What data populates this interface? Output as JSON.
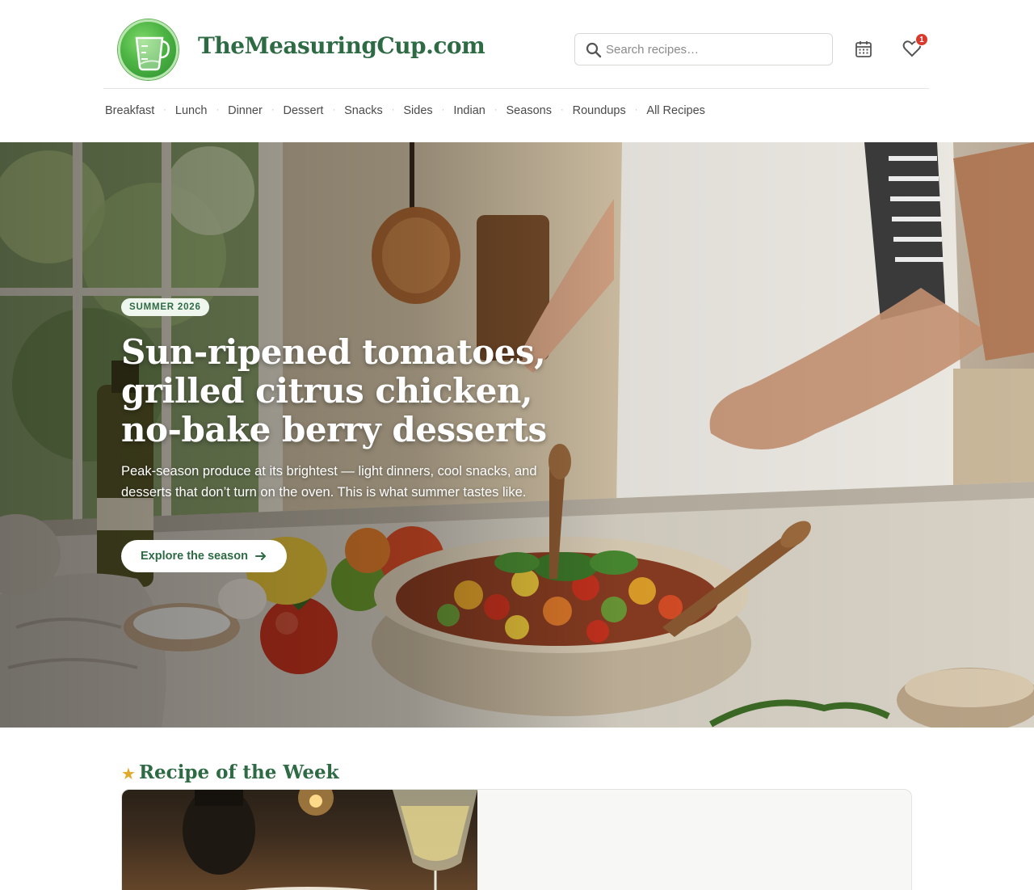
{
  "header": {
    "site_title": "TheMeasuringCup.com",
    "logo_icon": "measuring-cup-icon",
    "search": {
      "placeholder": "Search recipes…",
      "value": ""
    },
    "favorites_count": "1"
  },
  "nav": {
    "items": [
      "Breakfast",
      "Lunch",
      "Dinner",
      "Dessert",
      "Snacks",
      "Sides",
      "Indian",
      "Seasons",
      "Roundups",
      "All Recipes"
    ],
    "separator": "·"
  },
  "hero": {
    "badge": "SUMMER 2026",
    "title": "Sun-ripened tomatoes, grilled citrus chicken, no-bake berry desserts",
    "subtitle": "Peak-season produce at its brightest — light dinners, cool snacks, and desserts that don’t turn on the oven. This is what summer tastes like.",
    "cta_label": "Explore the season"
  },
  "recipe_of_week": {
    "heading": "Recipe of the Week"
  },
  "colors": {
    "brand_green": "#2e6b45",
    "badge_red": "#d93a2b",
    "star_gold": "#e0a92a"
  }
}
